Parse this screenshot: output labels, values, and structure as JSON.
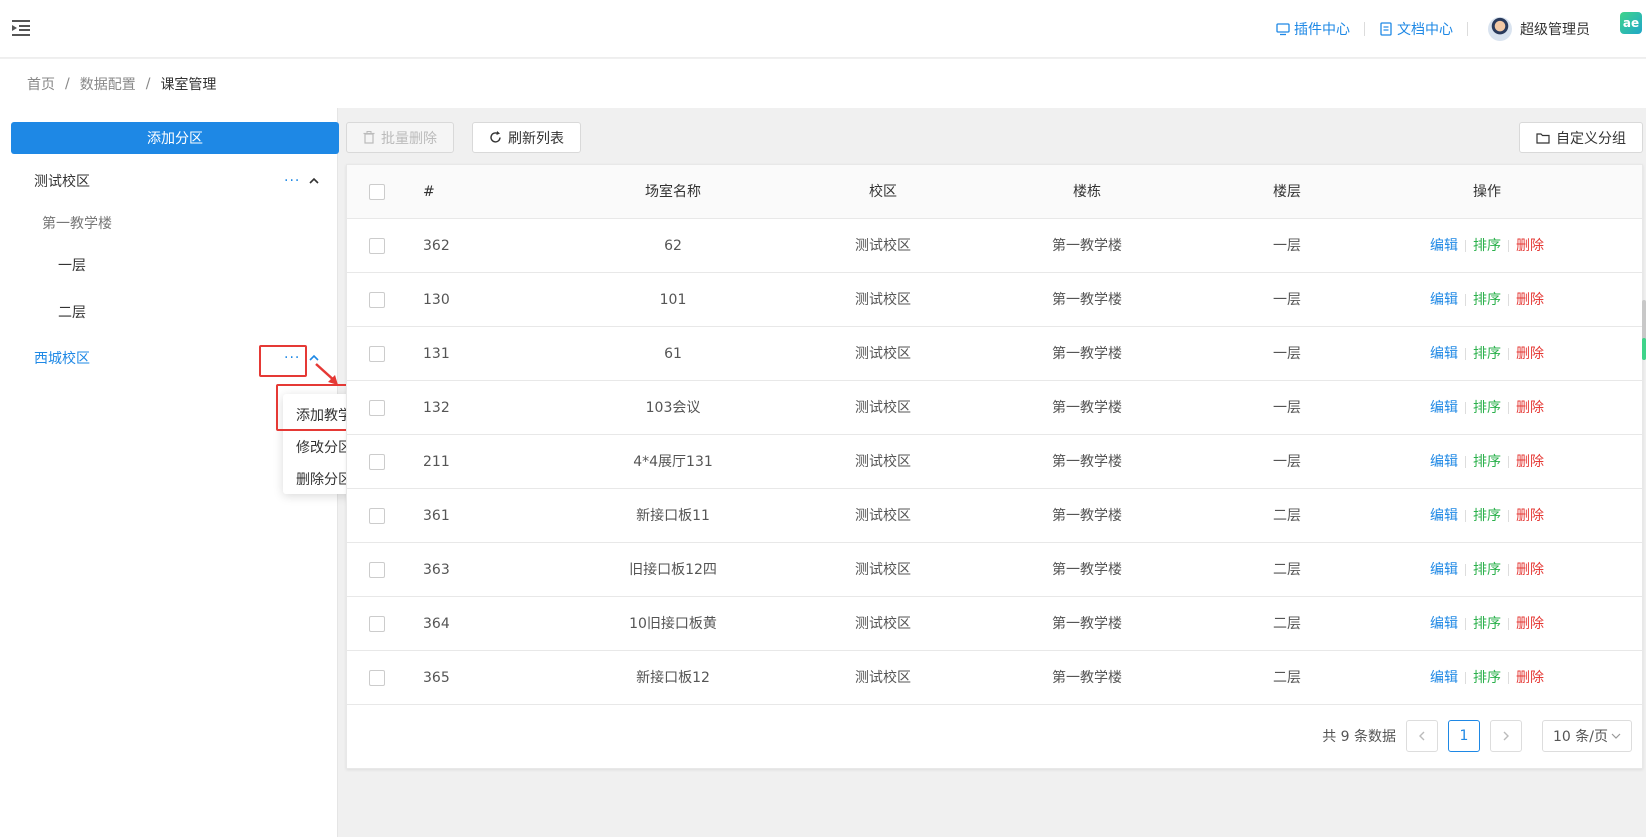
{
  "header": {
    "links": [
      {
        "label": "插件中心",
        "icon": "plugin-icon"
      },
      {
        "label": "文档中心",
        "icon": "document-icon"
      }
    ],
    "user_name": "超级管理员",
    "badge": "ae"
  },
  "breadcrumb": [
    "首页",
    "数据配置",
    "课室管理"
  ],
  "sidebar": {
    "add_button": "添加分区",
    "tree": [
      {
        "label": "测试校区",
        "level": 0,
        "has_menu": true,
        "expanded": true
      },
      {
        "label": "第一教学楼",
        "level": 1
      },
      {
        "label": "一层",
        "level": 2
      },
      {
        "label": "二层",
        "level": 2
      },
      {
        "label": "西城校区",
        "level": 0,
        "has_menu": true,
        "active": true
      }
    ],
    "dots": "···",
    "dropdown": [
      "添加教学楼",
      "修改分区",
      "删除分区"
    ]
  },
  "toolbar": {
    "batch_delete": "批量删除",
    "refresh": "刷新列表",
    "custom_group": "自定义分组"
  },
  "table": {
    "headers": [
      "#",
      "场室名称",
      "校区",
      "楼栋",
      "楼层",
      "操作"
    ],
    "rows": [
      {
        "id": "362",
        "name": "62",
        "campus": "测试校区",
        "building": "第一教学楼",
        "floor": "一层"
      },
      {
        "id": "130",
        "name": "101",
        "campus": "测试校区",
        "building": "第一教学楼",
        "floor": "一层"
      },
      {
        "id": "131",
        "name": "61",
        "campus": "测试校区",
        "building": "第一教学楼",
        "floor": "一层"
      },
      {
        "id": "132",
        "name": "103会议",
        "campus": "测试校区",
        "building": "第一教学楼",
        "floor": "一层"
      },
      {
        "id": "211",
        "name": "4*4展厅131",
        "campus": "测试校区",
        "building": "第一教学楼",
        "floor": "一层"
      },
      {
        "id": "361",
        "name": "新接口板11",
        "campus": "测试校区",
        "building": "第一教学楼",
        "floor": "二层"
      },
      {
        "id": "363",
        "name": "旧接口板12四",
        "campus": "测试校区",
        "building": "第一教学楼",
        "floor": "二层"
      },
      {
        "id": "364",
        "name": "10旧接口板黄",
        "campus": "测试校区",
        "building": "第一教学楼",
        "floor": "二层"
      },
      {
        "id": "365",
        "name": "新接口板12",
        "campus": "测试校区",
        "building": "第一教学楼",
        "floor": "二层"
      }
    ],
    "ops": {
      "edit": "编辑",
      "sort": "排序",
      "delete": "删除"
    }
  },
  "pagination": {
    "total_text": "共 9 条数据",
    "current_page": "1",
    "page_size": "10 条/页"
  }
}
